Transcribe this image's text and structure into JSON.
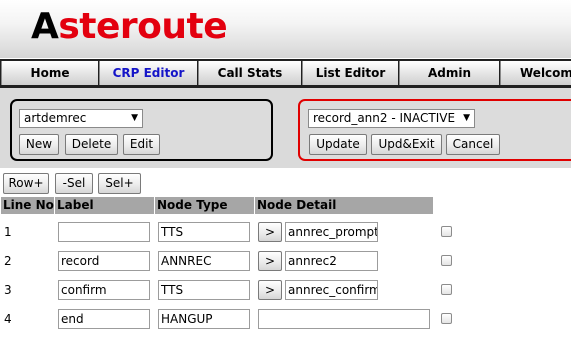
{
  "app": {
    "logo_first": "A",
    "logo_rest": "steroute"
  },
  "nav": {
    "items": [
      {
        "label": "Home"
      },
      {
        "label": "CRP Editor"
      },
      {
        "label": "Call Stats"
      },
      {
        "label": "List Editor"
      },
      {
        "label": "Admin"
      },
      {
        "label": "Welcome"
      }
    ],
    "active_index": 1
  },
  "left_panel": {
    "select_value": "artdemrec",
    "buttons": {
      "new": "New",
      "delete": "Delete",
      "edit": "Edit"
    }
  },
  "right_panel": {
    "select_value": "record_ann2 - INACTIVE",
    "buttons": {
      "update": "Update",
      "upd_exit": "Upd&Exit",
      "cancel": "Cancel"
    }
  },
  "row_buttons": {
    "row_plus": "Row+",
    "sel_minus": "-Sel",
    "sel_plus": "Sel+"
  },
  "table": {
    "headers": {
      "line_no": "Line No",
      "label": "Label",
      "node_type": "Node Type",
      "node_detail": "Node Detail"
    },
    "detail_button": ">",
    "rows": [
      {
        "line": "1",
        "label": "",
        "type": "TTS",
        "detail": "annrec_prompt",
        "has_button": true
      },
      {
        "line": "2",
        "label": "record",
        "type": "ANNREC",
        "detail": "annrec2",
        "has_button": true
      },
      {
        "line": "3",
        "label": "confirm",
        "type": "TTS",
        "detail": "annrec_confirm",
        "has_button": true
      },
      {
        "line": "4",
        "label": "end",
        "type": "HANGUP",
        "detail": "",
        "has_button": false
      }
    ]
  },
  "colors": {
    "logo_red": "#e3000f",
    "nav_active": "#1515c8",
    "right_panel_border": "#e00000",
    "table_header_bg": "#a6a6a6"
  },
  "icons": {
    "select_arrow": "dropdown-arrow-icon"
  }
}
